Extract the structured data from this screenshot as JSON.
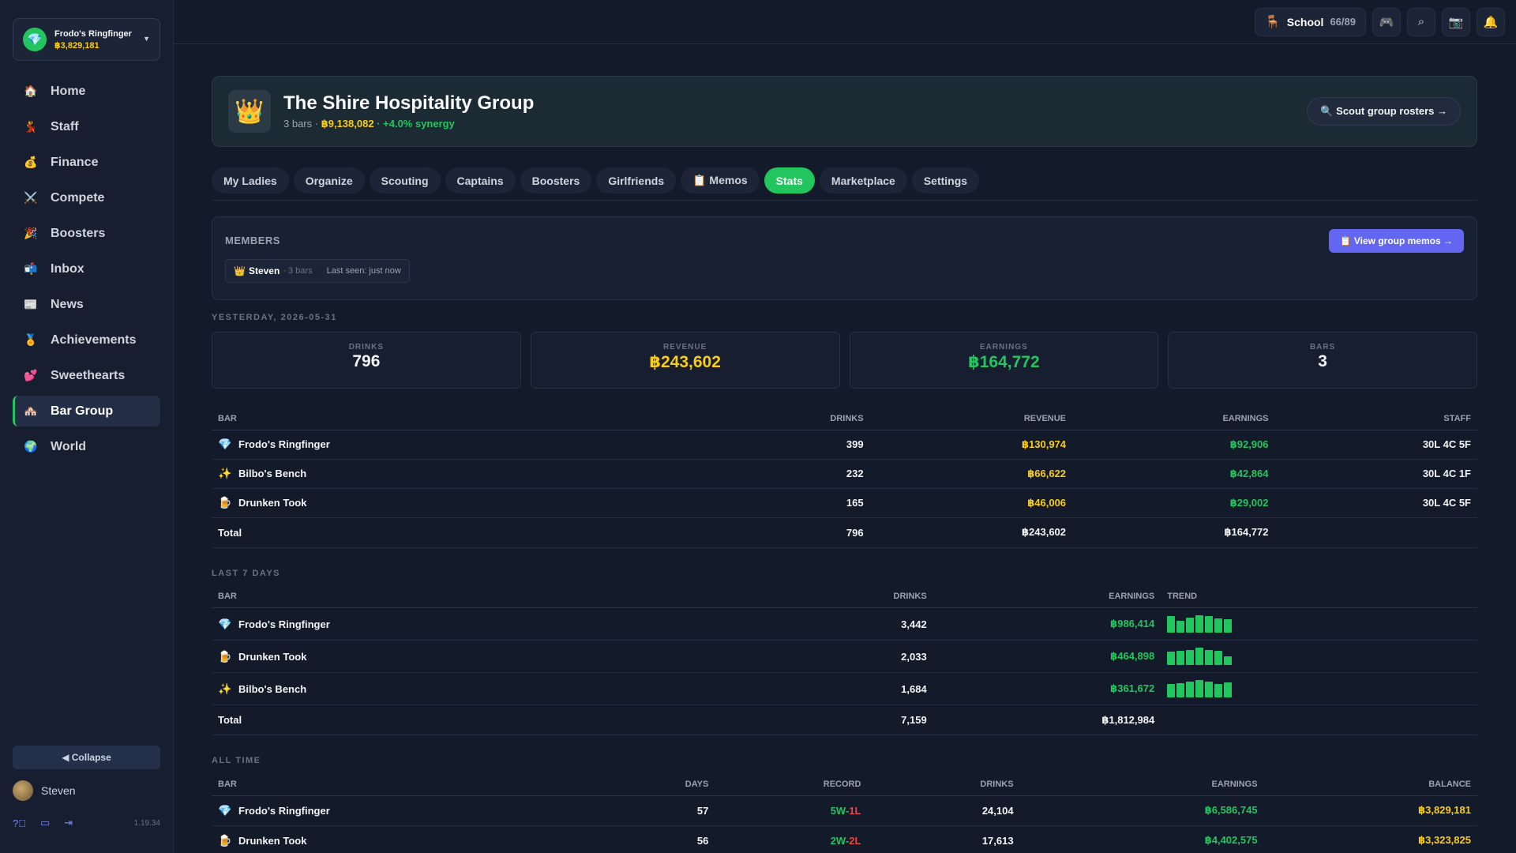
{
  "sidebar": {
    "bar_switch": {
      "name": "Frodo's Ringfinger",
      "balance": "฿3,829,181"
    },
    "nav": [
      {
        "icon": "🏠",
        "icon_name": "home-icon",
        "label": "Home"
      },
      {
        "icon": "💃",
        "icon_name": "dancer-icon",
        "label": "Staff"
      },
      {
        "icon": "💰",
        "icon_name": "money-bag-icon",
        "label": "Finance"
      },
      {
        "icon": "⚔️",
        "icon_name": "swords-icon",
        "label": "Compete"
      },
      {
        "icon": "🎉",
        "icon_name": "party-icon",
        "label": "Boosters"
      },
      {
        "icon": "📬",
        "icon_name": "mailbox-icon",
        "label": "Inbox"
      },
      {
        "icon": "📰",
        "icon_name": "newspaper-icon",
        "label": "News"
      },
      {
        "icon": "🏅",
        "icon_name": "medal-icon",
        "label": "Achievements"
      },
      {
        "icon": "💕",
        "icon_name": "hearts-icon",
        "label": "Sweethearts"
      },
      {
        "icon": "🏘️",
        "icon_name": "houses-icon",
        "label": "Bar Group",
        "active": true
      },
      {
        "icon": "🌍",
        "icon_name": "globe-icon",
        "label": "World"
      }
    ],
    "collapse_label": "◀ Collapse",
    "user_name": "Steven",
    "version": "1.19.34"
  },
  "topbar": {
    "school_label": "School",
    "school_count": "66/89"
  },
  "group": {
    "title": "The Shire Hospitality Group",
    "bars_text": "3 bars · ",
    "value": "฿9,138,082",
    "synergy": " · +4.0% synergy",
    "scout_label": "🔍 Scout group rosters →"
  },
  "tabs": [
    "My Ladies",
    "Organize",
    "Scouting",
    "Captains",
    "Boosters",
    "Girlfriends",
    "📋 Memos",
    "Stats",
    "Marketplace",
    "Settings"
  ],
  "active_tab": "Stats",
  "members": {
    "title": "MEMBERS",
    "memo_button": "📋 View group memos →",
    "member": {
      "crown": "👑",
      "name": "Steven",
      "meta": "· 3 bars",
      "seen": "Last seen: just now"
    }
  },
  "yesterday": {
    "label": "YESTERDAY, 2026-05-31",
    "cards": {
      "drinks": {
        "title": "DRINKS",
        "value": "796"
      },
      "revenue": {
        "title": "REVENUE",
        "value": "฿243,602"
      },
      "earnings": {
        "title": "EARNINGS",
        "value": "฿164,772"
      },
      "bars": {
        "title": "BARS",
        "value": "3"
      }
    },
    "headers": {
      "bar": "BAR",
      "drinks": "DRINKS",
      "revenue": "REVENUE",
      "earnings": "EARNINGS",
      "staff": "STAFF"
    },
    "rows": [
      {
        "icon": "💎",
        "name": "Frodo's Ringfinger",
        "drinks": "399",
        "revenue": "฿130,974",
        "earnings": "฿92,906",
        "staff": "30L 4C 5F"
      },
      {
        "icon": "✨",
        "name": "Bilbo's Bench",
        "drinks": "232",
        "revenue": "฿66,622",
        "earnings": "฿42,864",
        "staff": "30L 4C 1F"
      },
      {
        "icon": "🍺",
        "name": "Drunken Took",
        "drinks": "165",
        "revenue": "฿46,006",
        "earnings": "฿29,002",
        "staff": "30L 4C 5F"
      }
    ],
    "total": {
      "label": "Total",
      "drinks": "796",
      "revenue": "฿243,602",
      "earnings": "฿164,772"
    }
  },
  "last7": {
    "label": "LAST 7 DAYS",
    "headers": {
      "bar": "BAR",
      "drinks": "DRINKS",
      "earnings": "EARNINGS",
      "trend": "TREND"
    },
    "rows": [
      {
        "icon": "💎",
        "name": "Frodo's Ringfinger",
        "drinks": "3,442",
        "earnings": "฿986,414",
        "trend": [
          0.95,
          0.7,
          0.85,
          1.0,
          0.95,
          0.8,
          0.75
        ]
      },
      {
        "icon": "🍺",
        "name": "Drunken Took",
        "drinks": "2,033",
        "earnings": "฿464,898",
        "trend": [
          0.75,
          0.8,
          0.85,
          1.0,
          0.85,
          0.8,
          0.5
        ]
      },
      {
        "icon": "✨",
        "name": "Bilbo's Bench",
        "drinks": "1,684",
        "earnings": "฿361,672",
        "trend": [
          0.75,
          0.8,
          0.9,
          1.0,
          0.9,
          0.75,
          0.85
        ]
      }
    ],
    "total": {
      "label": "Total",
      "drinks": "7,159",
      "earnings": "฿1,812,984"
    }
  },
  "alltime": {
    "label": "ALL TIME",
    "headers": {
      "bar": "BAR",
      "days": "DAYS",
      "record": "RECORD",
      "drinks": "DRINKS",
      "earnings": "EARNINGS",
      "balance": "BALANCE"
    },
    "rows": [
      {
        "icon": "💎",
        "name": "Frodo's Ringfinger",
        "days": "57",
        "w": "5W",
        "l": "1L",
        "drinks": "24,104",
        "earnings": "฿6,586,745",
        "balance": "฿3,829,181"
      },
      {
        "icon": "🍺",
        "name": "Drunken Took",
        "days": "56",
        "w": "2W",
        "l": "2L",
        "drinks": "17,613",
        "earnings": "฿4,402,575",
        "balance": "฿3,323,825"
      }
    ]
  }
}
